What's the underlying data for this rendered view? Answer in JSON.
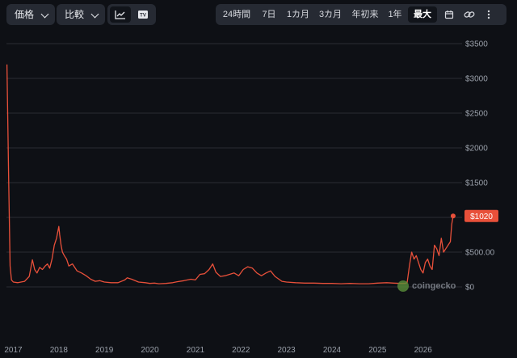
{
  "toolbar": {
    "dropdowns": [
      "価格",
      "比較"
    ],
    "ranges": [
      "24時間",
      "7日",
      "1カ月",
      "3カ月",
      "年初来",
      "1年",
      "最大"
    ],
    "active_range": "最大"
  },
  "watermark": "coingecko",
  "colors": {
    "line": "#e8503a",
    "background": "#0e1015",
    "grid": "#2a2d34",
    "label_bg": "#e8503a"
  },
  "chart_data": {
    "type": "line",
    "title": "",
    "xlabel": "",
    "ylabel": "",
    "ylim": [
      0,
      3500
    ],
    "y_ticks": [
      "$3500",
      "$3000",
      "$2500",
      "$2000",
      "$1500",
      "$1000",
      "$500.00",
      "$0"
    ],
    "y_tick_values": [
      3500,
      3000,
      2500,
      2000,
      1500,
      1000,
      500,
      0
    ],
    "x_ticks": [
      "2017",
      "2018",
      "2019",
      "2020",
      "2021",
      "2022",
      "2023",
      "2024",
      "2025",
      "2026"
    ],
    "x_tick_values": [
      2017,
      2018,
      2019,
      2020,
      2021,
      2022,
      2023,
      2024,
      2025,
      2026
    ],
    "xlim": [
      2016.85,
      2026.75
    ],
    "last_price_label": "$1020",
    "last_price": 1020,
    "series": [
      {
        "x": [
          2016.86,
          2016.9,
          2016.93,
          2016.96,
          2017.0,
          2017.1,
          2017.25,
          2017.35,
          2017.42,
          2017.47,
          2017.52,
          2017.58,
          2017.64,
          2017.7,
          2017.75,
          2017.8,
          2017.85,
          2017.9,
          2017.95,
          2018.0,
          2018.02,
          2018.05,
          2018.08,
          2018.12,
          2018.17,
          2018.22,
          2018.3,
          2018.35,
          2018.4,
          2018.5,
          2018.6,
          2018.7,
          2018.8,
          2018.9,
          2019.0,
          2019.15,
          2019.3,
          2019.45,
          2019.5,
          2019.6,
          2019.75,
          2019.9,
          2020.0,
          2020.1,
          2020.2,
          2020.35,
          2020.5,
          2020.6,
          2020.75,
          2020.9,
          2021.0,
          2021.1,
          2021.2,
          2021.3,
          2021.38,
          2021.45,
          2021.55,
          2021.65,
          2021.75,
          2021.85,
          2021.95,
          2022.05,
          2022.15,
          2022.25,
          2022.35,
          2022.45,
          2022.55,
          2022.65,
          2022.75,
          2022.9,
          2023.0,
          2023.2,
          2023.4,
          2023.6,
          2023.8,
          2024.0,
          2024.2,
          2024.4,
          2024.6,
          2024.8,
          2025.0,
          2025.2,
          2025.35,
          2025.5,
          2025.6,
          2025.65,
          2025.7,
          2025.75,
          2025.8,
          2025.85,
          2025.9,
          2025.95,
          2026.0,
          2026.05,
          2026.1,
          2026.15,
          2026.2,
          2026.25,
          2026.3,
          2026.35,
          2026.4,
          2026.45,
          2026.5,
          2026.55,
          2026.6,
          2026.63,
          2026.66
        ],
        "y": [
          3200,
          1500,
          300,
          100,
          70,
          60,
          80,
          150,
          390,
          250,
          200,
          280,
          250,
          300,
          330,
          270,
          400,
          600,
          700,
          870,
          750,
          600,
          500,
          450,
          400,
          300,
          330,
          280,
          230,
          200,
          160,
          110,
          80,
          90,
          70,
          60,
          60,
          100,
          130,
          110,
          70,
          60,
          50,
          55,
          45,
          50,
          60,
          75,
          90,
          110,
          100,
          180,
          190,
          250,
          330,
          210,
          150,
          160,
          180,
          200,
          160,
          250,
          290,
          270,
          200,
          160,
          200,
          230,
          150,
          80,
          70,
          60,
          55,
          55,
          50,
          50,
          45,
          50,
          45,
          45,
          55,
          60,
          55,
          50,
          50,
          60,
          300,
          500,
          400,
          450,
          350,
          250,
          200,
          350,
          400,
          300,
          250,
          600,
          550,
          450,
          700,
          500,
          550,
          600,
          650,
          900,
          1020
        ]
      }
    ]
  }
}
